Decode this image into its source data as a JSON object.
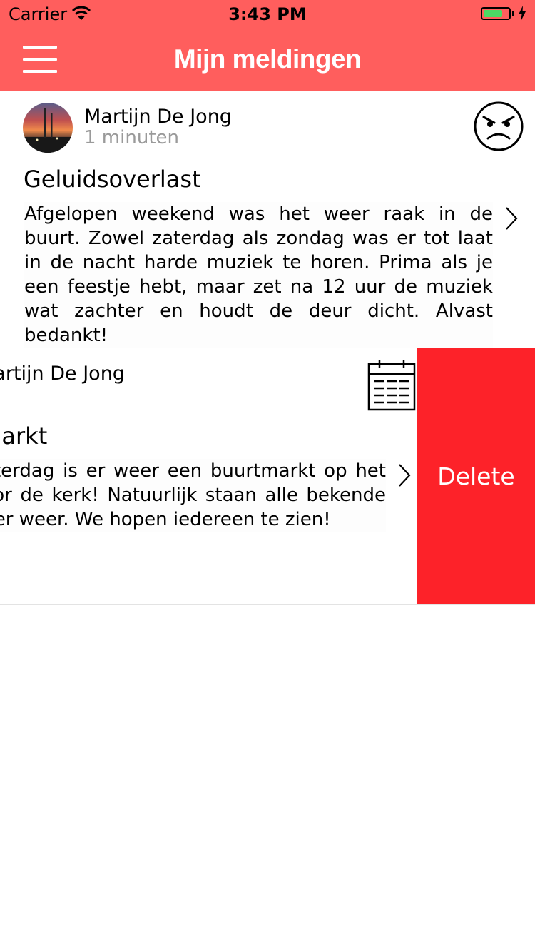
{
  "status_bar": {
    "carrier": "Carrier",
    "time": "3:43 PM",
    "battery_level": 0.75
  },
  "nav": {
    "title": "Mijn meldingen",
    "menu_icon": "hamburger-menu-icon"
  },
  "notifications": [
    {
      "author": "Martijn De Jong",
      "time_ago": "1 minuten",
      "title": "Geluidsoverlast",
      "body": "Afgelopen weekend was het weer raak in de buurt. Zowel zaterdag als zondag was er tot laat in de nacht harde muziek te horen. Prima als je een feestje hebt, maar zet na 12 uur de muziek wat zachter en houdt de deur dicht. Alvast bedankt!",
      "type_icon": "angry-face-icon"
    },
    {
      "author": "Martijn De Jong",
      "title": "Buurtmarkt",
      "body": "Deze zaterdag is er weer een buurtmarkt op het plein voor de kerk! Natuurlijk staan alle bekende kramen er weer. We hopen iedereen te zien!",
      "type_icon": "calendar-icon",
      "swiped": true,
      "delete_label": "Delete"
    }
  ],
  "colors": {
    "nav_background": "#ff5e5d",
    "delete_background": "#fd2229",
    "secondary_text": "#9a9a9a"
  }
}
